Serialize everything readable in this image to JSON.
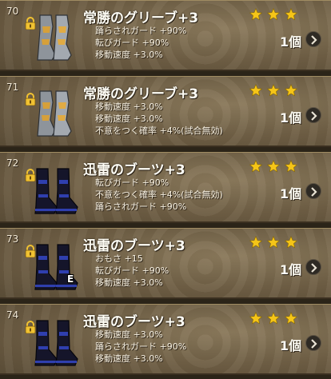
{
  "items": [
    {
      "number": "70",
      "name": "常勝のグリーブ+3",
      "icon": "greaves-icon",
      "equipped": false,
      "stats": [
        "踊らされガード +90%",
        "転びガード +90%",
        "移動速度 +3.0%"
      ],
      "count": "1個",
      "stars": 3
    },
    {
      "number": "71",
      "name": "常勝のグリーブ+3",
      "icon": "greaves-icon",
      "equipped": false,
      "stats": [
        "移動速度 +3.0%",
        "移動速度 +3.0%",
        "不意をつく確率 +4%(試合無効)"
      ],
      "count": "1個",
      "stars": 3
    },
    {
      "number": "72",
      "name": "迅雷のブーツ+3",
      "icon": "boots-icon",
      "equipped": false,
      "stats": [
        "転びガード +90%",
        "不意をつく確率 +4%(試合無効)",
        "踊らされガード +90%"
      ],
      "count": "1個",
      "stars": 3
    },
    {
      "number": "73",
      "name": "迅雷のブーツ+3",
      "icon": "boots-icon",
      "equipped": true,
      "equipped_label": "E",
      "stats": [
        "おもさ +15",
        "転びガード +90%",
        "移動速度 +3.0%"
      ],
      "count": "1個",
      "stars": 3
    },
    {
      "number": "74",
      "name": "迅雷のブーツ+3",
      "icon": "boots-icon",
      "equipped": false,
      "stats": [
        "移動速度 +3.0%",
        "踊らされガード +90%",
        "移動速度 +3.0%"
      ],
      "count": "1個",
      "stars": 3
    }
  ],
  "colors": {
    "star": "#f5c518",
    "lock": "#f1c232",
    "greaves_metal": "#9aa0a6",
    "greaves_gold": "#d6a03a",
    "boots_dark": "#15152a",
    "boots_blue": "#2f3fae"
  }
}
